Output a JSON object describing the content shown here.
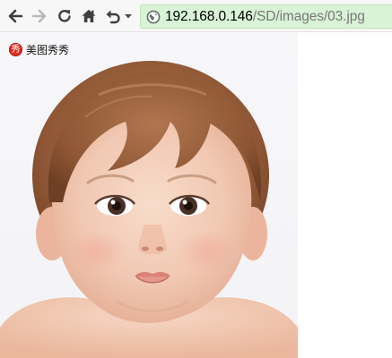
{
  "toolbar": {
    "back_icon": "arrow-left-icon",
    "forward_icon": "arrow-right-icon",
    "reload_icon": "reload-icon",
    "home_icon": "home-icon",
    "undo_icon": "undo-history-icon",
    "dropdown_icon": "chevron-down-icon"
  },
  "address_bar": {
    "icon": "globe-icon",
    "host": "192.168.0.146",
    "path": "/SD/images/03.jpg",
    "background_color": "#d9f3d6"
  },
  "overlay": {
    "badge_glyph": "秀",
    "label": "美图秀秀",
    "badge_color": "#e22c1f"
  }
}
